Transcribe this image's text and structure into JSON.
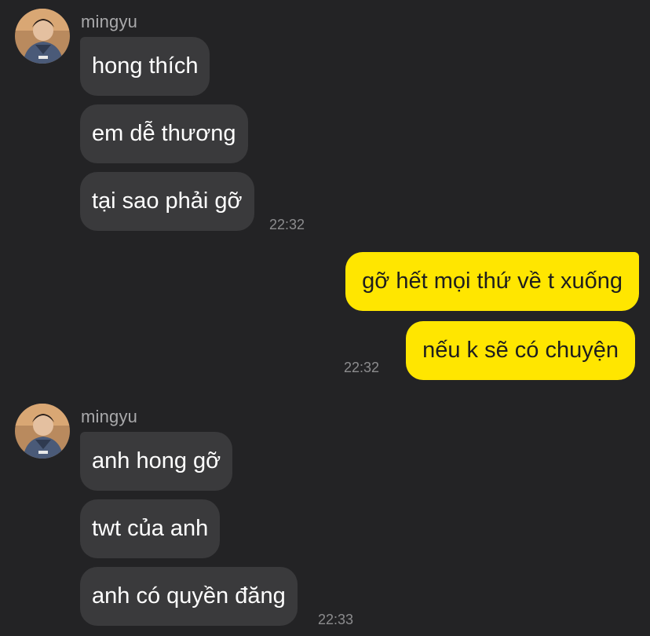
{
  "groups": [
    {
      "sender": "mingyu",
      "avatar_icon": "user-avatar-photo",
      "messages": [
        "hong thích",
        "em dễ thương",
        "tại sao phải gỡ"
      ],
      "time": "22:32"
    },
    {
      "sender": "me",
      "messages": [
        "gỡ hết mọi thứ về t xuống",
        "nếu k sẽ có chuyện"
      ],
      "time": "22:32"
    },
    {
      "sender": "mingyu",
      "avatar_icon": "user-avatar-photo",
      "messages": [
        "anh hong gỡ",
        "twt của anh",
        "anh có quyền đăng"
      ],
      "time": "22:33"
    }
  ],
  "colors": {
    "background": "#232325",
    "incoming_bubble": "#3a3a3c",
    "outgoing_bubble": "#ffe600",
    "incoming_text": "#ffffff",
    "outgoing_text": "#1e1e1e",
    "meta_text": "#8c8c8e"
  }
}
